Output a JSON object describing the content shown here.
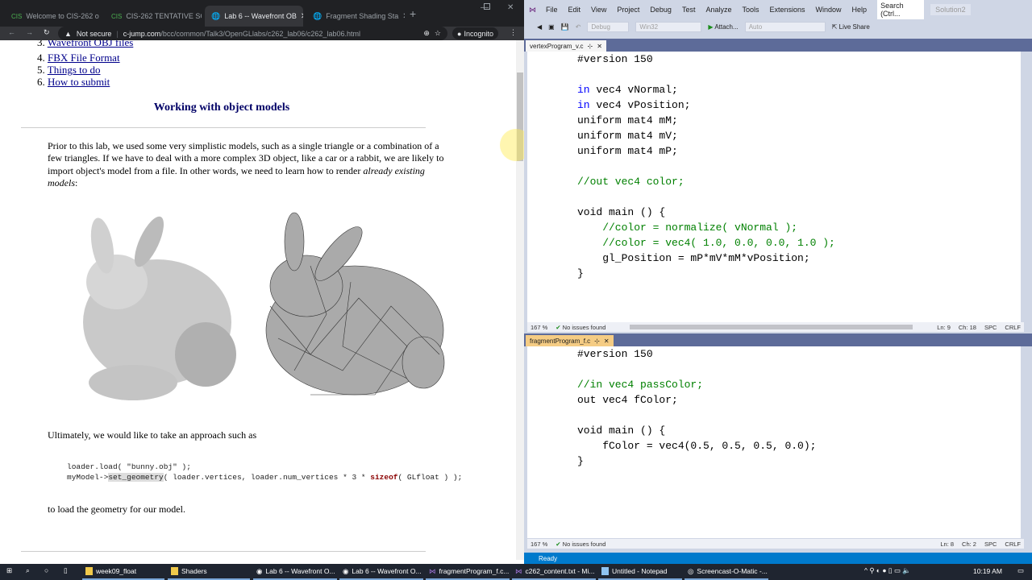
{
  "browser": {
    "tabs": [
      {
        "label": "Welcome to CIS-262 o",
        "icon": "cis-favicon"
      },
      {
        "label": "CIS-262 TENTATIVE SC",
        "icon": "cis-favicon"
      },
      {
        "label": "Lab 6 -- Wavefront OB",
        "icon": "globe-icon"
      },
      {
        "label": "Fragment Shading Sta",
        "icon": "globe-icon"
      }
    ],
    "security": "Not secure",
    "url_host": "c-jump.com",
    "url_path": "/bcc/common/Talk3/OpenGLlabs/c262_lab06/c262_lab06.html",
    "profile": "Incognito"
  },
  "page": {
    "toc": [
      {
        "num": "3.",
        "label": "Wavefront OBJ files"
      },
      {
        "num": "4.",
        "label": "FBX File Format"
      },
      {
        "num": "5.",
        "label": "Things to do"
      },
      {
        "num": "6.",
        "label": "How to submit"
      }
    ],
    "heading": "Working with object models",
    "intro": "Prior to this lab, we used some very simplistic models, such as a single triangle or a combination of a few triangles. If we have to deal with a more complex 3D object, like a car or a rabbit, we are likely to import object's model from a file. In other words, we need to learn how to render ",
    "intro_em": "already existing models",
    "intro_end": ":",
    "approach": "Ultimately, we would like to take an approach such as",
    "code1": "loader.load( \"bunny.obj\" );",
    "code2_a": "myModel->",
    "code2_fn": "set_geometry",
    "code2_b": "( loader.vertices, loader.num_vertices * 3 * ",
    "code2_kw": "sizeof",
    "code2_c": "( GLfloat ) );",
    "closing": "to load the geometry for our model."
  },
  "vs": {
    "menu": [
      "File",
      "Edit",
      "View",
      "Project",
      "Debug",
      "Test",
      "Analyze",
      "Tools",
      "Extensions",
      "Window",
      "Help"
    ],
    "search": "Search (Ctrl...",
    "solution": "Solution2",
    "config": "Debug",
    "platform": "Win32",
    "attach": "Attach...",
    "auto": "Auto",
    "live_share": "Live Share",
    "editor1": {
      "tab": "vertexProgram_v.c",
      "zoom": "167 %",
      "issues": "No issues found",
      "ln": "Ln: 9",
      "ch": "Ch: 18",
      "spc": "SPC",
      "crlf": "CRLF"
    },
    "editor2": {
      "tab": "fragmentProgram_f.c",
      "zoom": "167 %",
      "issues": "No issues found",
      "ln": "Ln: 8",
      "ch": "Ch: 2",
      "spc": "SPC",
      "crlf": "CRLF"
    },
    "status": "Ready"
  },
  "taskbar": {
    "items": [
      "week09_float",
      "Shaders",
      "Lab 6 -- Wavefront O...",
      "Lab 6 -- Wavefront O...",
      "fragmentProgram_f.c...",
      "c262_content.txt - Mi...",
      "Untitled - Notepad",
      "Screencast-O-Matic -..."
    ],
    "time": "10:19 AM"
  }
}
